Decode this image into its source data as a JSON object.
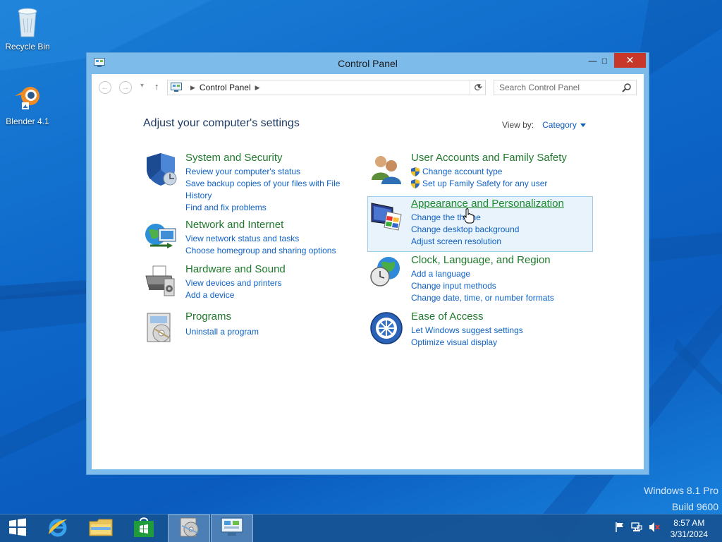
{
  "desktop": {
    "icons": [
      {
        "label": "Recycle Bin",
        "icon": "recycle-bin-icon"
      },
      {
        "label": "Blender 4.1",
        "icon": "blender-icon"
      }
    ],
    "watermark": {
      "line1": "Windows 8.1 Pro",
      "line2": "Build 9600"
    }
  },
  "window": {
    "title": "Control Panel",
    "buttons": {
      "minimize": "—",
      "maximize": "□",
      "close": "✕"
    }
  },
  "address": {
    "back": "←",
    "forward": "→",
    "recent": "▾",
    "up": "↑",
    "crumb": "Control Panel",
    "search_placeholder": "Search Control Panel"
  },
  "content": {
    "heading": "Adjust your computer's settings",
    "view_by_label": "View by:",
    "view_by_value": "Category",
    "categories_left": [
      {
        "title": "System and Security",
        "icon": "shield-icon",
        "links": [
          "Review your computer's status",
          "Save backup copies of your files with File",
          "History",
          "Find and fix problems"
        ]
      },
      {
        "title": "Network and Internet",
        "icon": "network-icon",
        "links": [
          "View network status and tasks",
          "Choose homegroup and sharing options"
        ]
      },
      {
        "title": "Hardware and Sound",
        "icon": "printer-icon",
        "links": [
          "View devices and printers",
          "Add a device"
        ]
      },
      {
        "title": "Programs",
        "icon": "programs-icon",
        "links": [
          "Uninstall a program"
        ]
      }
    ],
    "categories_right": [
      {
        "title": "User Accounts and Family Safety",
        "icon": "users-icon",
        "links": [
          "Change account type",
          "Set up Family Safety for any user"
        ]
      },
      {
        "title": "Appearance and Personalization",
        "icon": "appearance-icon",
        "links": [
          "Change the theme",
          "Change desktop background",
          "Adjust screen resolution"
        ],
        "highlighted": true
      },
      {
        "title": "Clock, Language, and Region",
        "icon": "clock-globe-icon",
        "links": [
          "Add a language",
          "Change input methods",
          "Change date, time, or number formats"
        ]
      },
      {
        "title": "Ease of Access",
        "icon": "ease-of-access-icon",
        "links": [
          "Let Windows suggest settings",
          "Optimize visual display"
        ]
      }
    ]
  },
  "taskbar": {
    "items": [
      "start-icon",
      "internet-explorer-icon",
      "file-explorer-icon",
      "store-icon",
      "media-icon",
      "control-panel-icon"
    ],
    "time": "8:57 AM",
    "date": "3/31/2024"
  },
  "colors": {
    "accent_green": "#207a2d",
    "link_blue": "#1062c6",
    "close_red": "#c7382b"
  }
}
